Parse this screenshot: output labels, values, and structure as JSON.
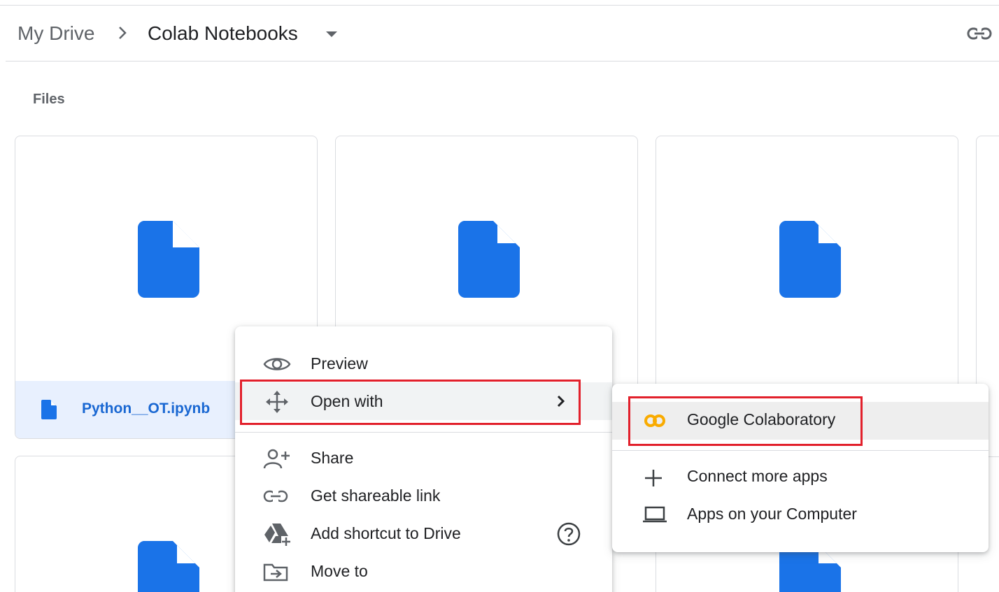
{
  "breadcrumb": {
    "root": "My Drive",
    "current": "Colab Notebooks"
  },
  "section": {
    "label": "Files"
  },
  "files": [
    {
      "name": "Python__OT.ipynb",
      "selected": true,
      "icon": "file-icon"
    },
    {
      "name": "",
      "icon": "file-icon"
    },
    {
      "name": "",
      "icon": "file-icon"
    },
    {
      "name": "",
      "icon": "file-icon"
    }
  ],
  "context_menu": {
    "items": [
      {
        "label": "Preview",
        "icon": "eye-icon"
      },
      {
        "label": "Open with",
        "icon": "move-arrows-icon",
        "has_submenu": true,
        "highlighted": true
      },
      {
        "label": "Share",
        "icon": "person-add-icon"
      },
      {
        "label": "Get shareable link",
        "icon": "link-icon"
      },
      {
        "label": "Add shortcut to Drive",
        "icon": "drive-shortcut-icon",
        "help_icon": "help-circle-icon"
      },
      {
        "label": "Move to",
        "icon": "folder-move-icon"
      }
    ]
  },
  "open_with_submenu": {
    "items": [
      {
        "label": "Google Colaboratory",
        "icon": "colab-icon",
        "highlighted": true
      },
      {
        "label": "Connect more apps",
        "icon": "plus-icon"
      },
      {
        "label": "Apps on your Computer",
        "icon": "laptop-icon"
      }
    ]
  },
  "colors": {
    "accent_blue": "#1a73e8",
    "selected_bg": "#e8f0fe",
    "highlight_border": "#e2202b",
    "colab_orange": "#f9ab00"
  }
}
